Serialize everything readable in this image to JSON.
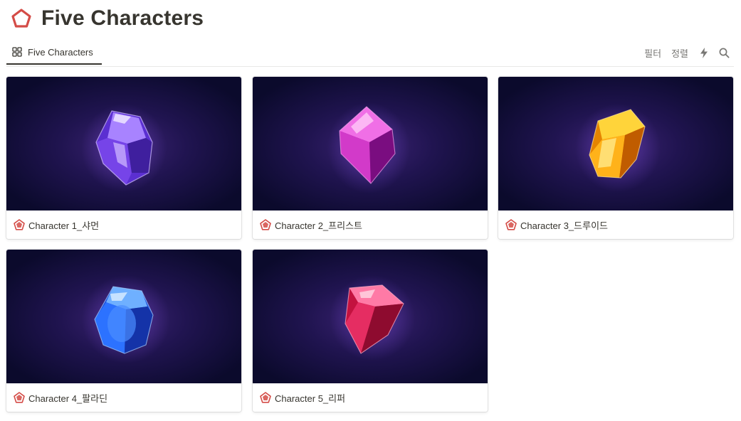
{
  "page": {
    "title": "Five Characters",
    "icon": "pentagon-icon",
    "accent_color": "#d44c47"
  },
  "view_tabs": [
    {
      "label": "Five Characters",
      "icon": "gallery-grid-icon"
    }
  ],
  "toolbar": {
    "filter_label": "필터",
    "sort_label": "정렬",
    "automation_icon": "lightning-icon",
    "search_icon": "search-icon"
  },
  "cards": [
    {
      "title": "Character 1_샤먼",
      "gem_color": "violet",
      "icon": "pentagon-badge-icon"
    },
    {
      "title": "Character 2_프리스트",
      "gem_color": "magenta",
      "icon": "pentagon-badge-icon"
    },
    {
      "title": "Character 3_드루이드",
      "gem_color": "amber",
      "icon": "pentagon-badge-icon"
    },
    {
      "title": "Character 4_팔라딘",
      "gem_color": "blue",
      "icon": "pentagon-badge-icon"
    },
    {
      "title": "Character 5_리퍼",
      "gem_color": "crimson",
      "icon": "pentagon-badge-icon"
    }
  ]
}
